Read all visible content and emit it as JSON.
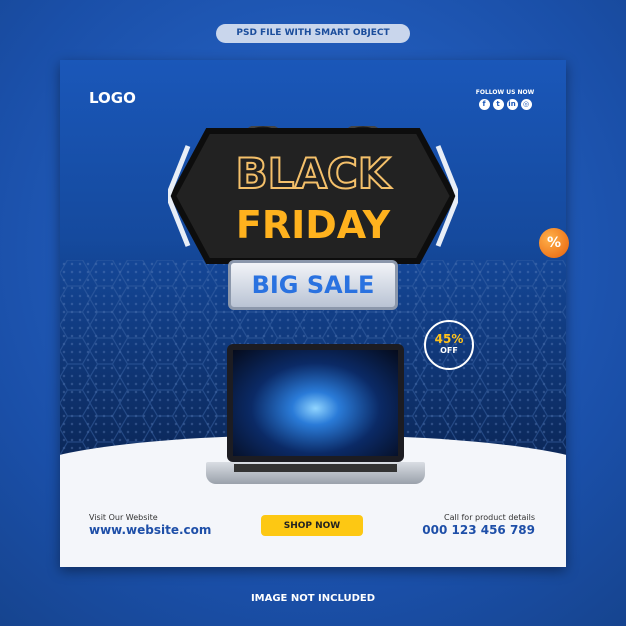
{
  "top_label": "PSD FILE WITH SMART OBJECT",
  "bottom_label": "IMAGE NOT INCLUDED",
  "poster": {
    "logo": "LOGO",
    "follow": {
      "label": "FOLLOW US NOW",
      "icons": [
        "facebook-icon",
        "twitter-icon",
        "linkedin-icon",
        "instagram-icon"
      ]
    },
    "headline_1": "BLACK",
    "headline_2": "FRIDAY",
    "subheadline": "BIG SALE",
    "discount": {
      "value": "45%",
      "label": "OFF"
    },
    "website": {
      "label": "Visit Our Website",
      "value": "www.website.com"
    },
    "cta": "SHOP NOW",
    "contact": {
      "label": "Call for product details",
      "value": "000 123 456 789"
    }
  },
  "colors": {
    "brand_blue": "#1a57b9",
    "accent_yellow": "#fdc813",
    "headline_orange": "#ffb21e"
  }
}
